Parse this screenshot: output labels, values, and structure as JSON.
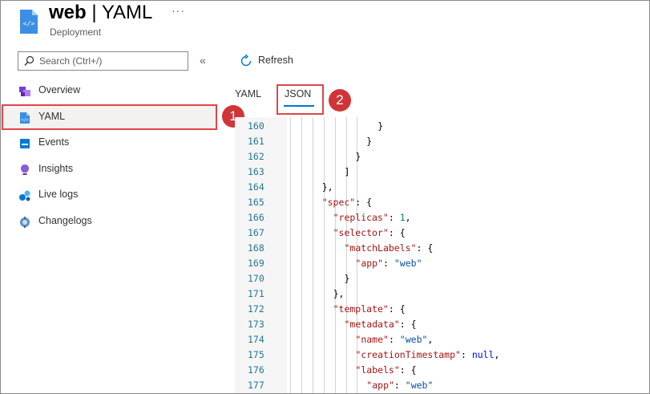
{
  "header": {
    "title_bold": "web",
    "title_rest": " | YAML",
    "subtitle": "Deployment",
    "more_label": "···"
  },
  "search": {
    "placeholder": "Search (Ctrl+/)"
  },
  "collapse_label": "«",
  "toolbar": {
    "refresh_label": "Refresh"
  },
  "sidebar": {
    "items": [
      {
        "label": "Overview",
        "icon": "overview-icon"
      },
      {
        "label": "YAML",
        "icon": "yaml-file-icon",
        "active": true
      },
      {
        "label": "Events",
        "icon": "events-icon"
      },
      {
        "label": "Insights",
        "icon": "insights-icon"
      },
      {
        "label": "Live logs",
        "icon": "live-logs-icon"
      },
      {
        "label": "Changelogs",
        "icon": "changelogs-icon"
      }
    ]
  },
  "tabs": [
    {
      "label": "YAML"
    },
    {
      "label": "JSON",
      "active": true
    }
  ],
  "callouts": {
    "one": "1",
    "two": "2"
  },
  "colors": {
    "accent": "#0078d4",
    "highlight": "#e0454a",
    "badge": "#d13438"
  },
  "editor": {
    "lines": [
      {
        "n": "160",
        "indent": 16,
        "tokens": [
          [
            "p",
            "}"
          ]
        ]
      },
      {
        "n": "161",
        "indent": 14,
        "tokens": [
          [
            "p",
            "}"
          ]
        ]
      },
      {
        "n": "162",
        "indent": 12,
        "tokens": [
          [
            "p",
            "}"
          ]
        ]
      },
      {
        "n": "163",
        "indent": 10,
        "tokens": [
          [
            "p",
            "]"
          ]
        ]
      },
      {
        "n": "164",
        "indent": 6,
        "tokens": [
          [
            "p",
            "},"
          ]
        ]
      },
      {
        "n": "165",
        "indent": 6,
        "tokens": [
          [
            "k",
            "\"spec\""
          ],
          [
            "p",
            ": {"
          ]
        ]
      },
      {
        "n": "166",
        "indent": 8,
        "tokens": [
          [
            "k",
            "\"replicas\""
          ],
          [
            "p",
            ": "
          ],
          [
            "n",
            "1"
          ],
          [
            "p",
            ","
          ]
        ]
      },
      {
        "n": "167",
        "indent": 8,
        "tokens": [
          [
            "k",
            "\"selector\""
          ],
          [
            "p",
            ": {"
          ]
        ]
      },
      {
        "n": "168",
        "indent": 10,
        "tokens": [
          [
            "k",
            "\"matchLabels\""
          ],
          [
            "p",
            ": {"
          ]
        ]
      },
      {
        "n": "169",
        "indent": 12,
        "tokens": [
          [
            "k",
            "\"app\""
          ],
          [
            "p",
            ": "
          ],
          [
            "s",
            "\"web\""
          ]
        ]
      },
      {
        "n": "170",
        "indent": 10,
        "tokens": [
          [
            "p",
            "}"
          ]
        ]
      },
      {
        "n": "171",
        "indent": 8,
        "tokens": [
          [
            "p",
            "},"
          ]
        ]
      },
      {
        "n": "172",
        "indent": 8,
        "tokens": [
          [
            "k",
            "\"template\""
          ],
          [
            "p",
            ": {"
          ]
        ]
      },
      {
        "n": "173",
        "indent": 10,
        "tokens": [
          [
            "k",
            "\"metadata\""
          ],
          [
            "p",
            ": {"
          ]
        ]
      },
      {
        "n": "174",
        "indent": 12,
        "tokens": [
          [
            "k",
            "\"name\""
          ],
          [
            "p",
            ": "
          ],
          [
            "s",
            "\"web\""
          ],
          [
            "p",
            ","
          ]
        ]
      },
      {
        "n": "175",
        "indent": 12,
        "tokens": [
          [
            "k",
            "\"creationTimestamp\""
          ],
          [
            "p",
            ": "
          ],
          [
            "kw",
            "null"
          ],
          [
            "p",
            ","
          ]
        ]
      },
      {
        "n": "176",
        "indent": 12,
        "tokens": [
          [
            "k",
            "\"labels\""
          ],
          [
            "p",
            ": {"
          ]
        ]
      },
      {
        "n": "177",
        "indent": 14,
        "tokens": [
          [
            "k",
            "\"app\""
          ],
          [
            "p",
            ": "
          ],
          [
            "s",
            "\"web\""
          ]
        ]
      }
    ]
  }
}
